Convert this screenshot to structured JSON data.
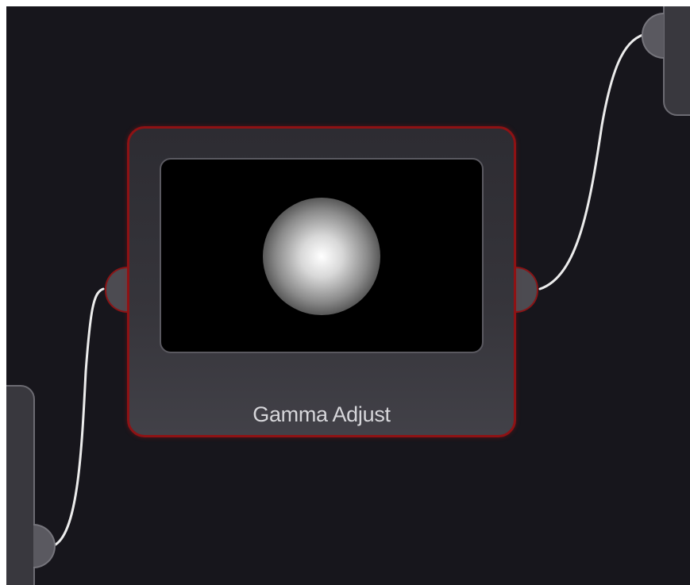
{
  "editor": {
    "background_color": "#17161c",
    "wire_color": "#e8e8e8",
    "selection_color": "#8e1214"
  },
  "node": {
    "title": "Gamma Adjust",
    "selected": true,
    "preview": "radial-gradient-sphere"
  }
}
